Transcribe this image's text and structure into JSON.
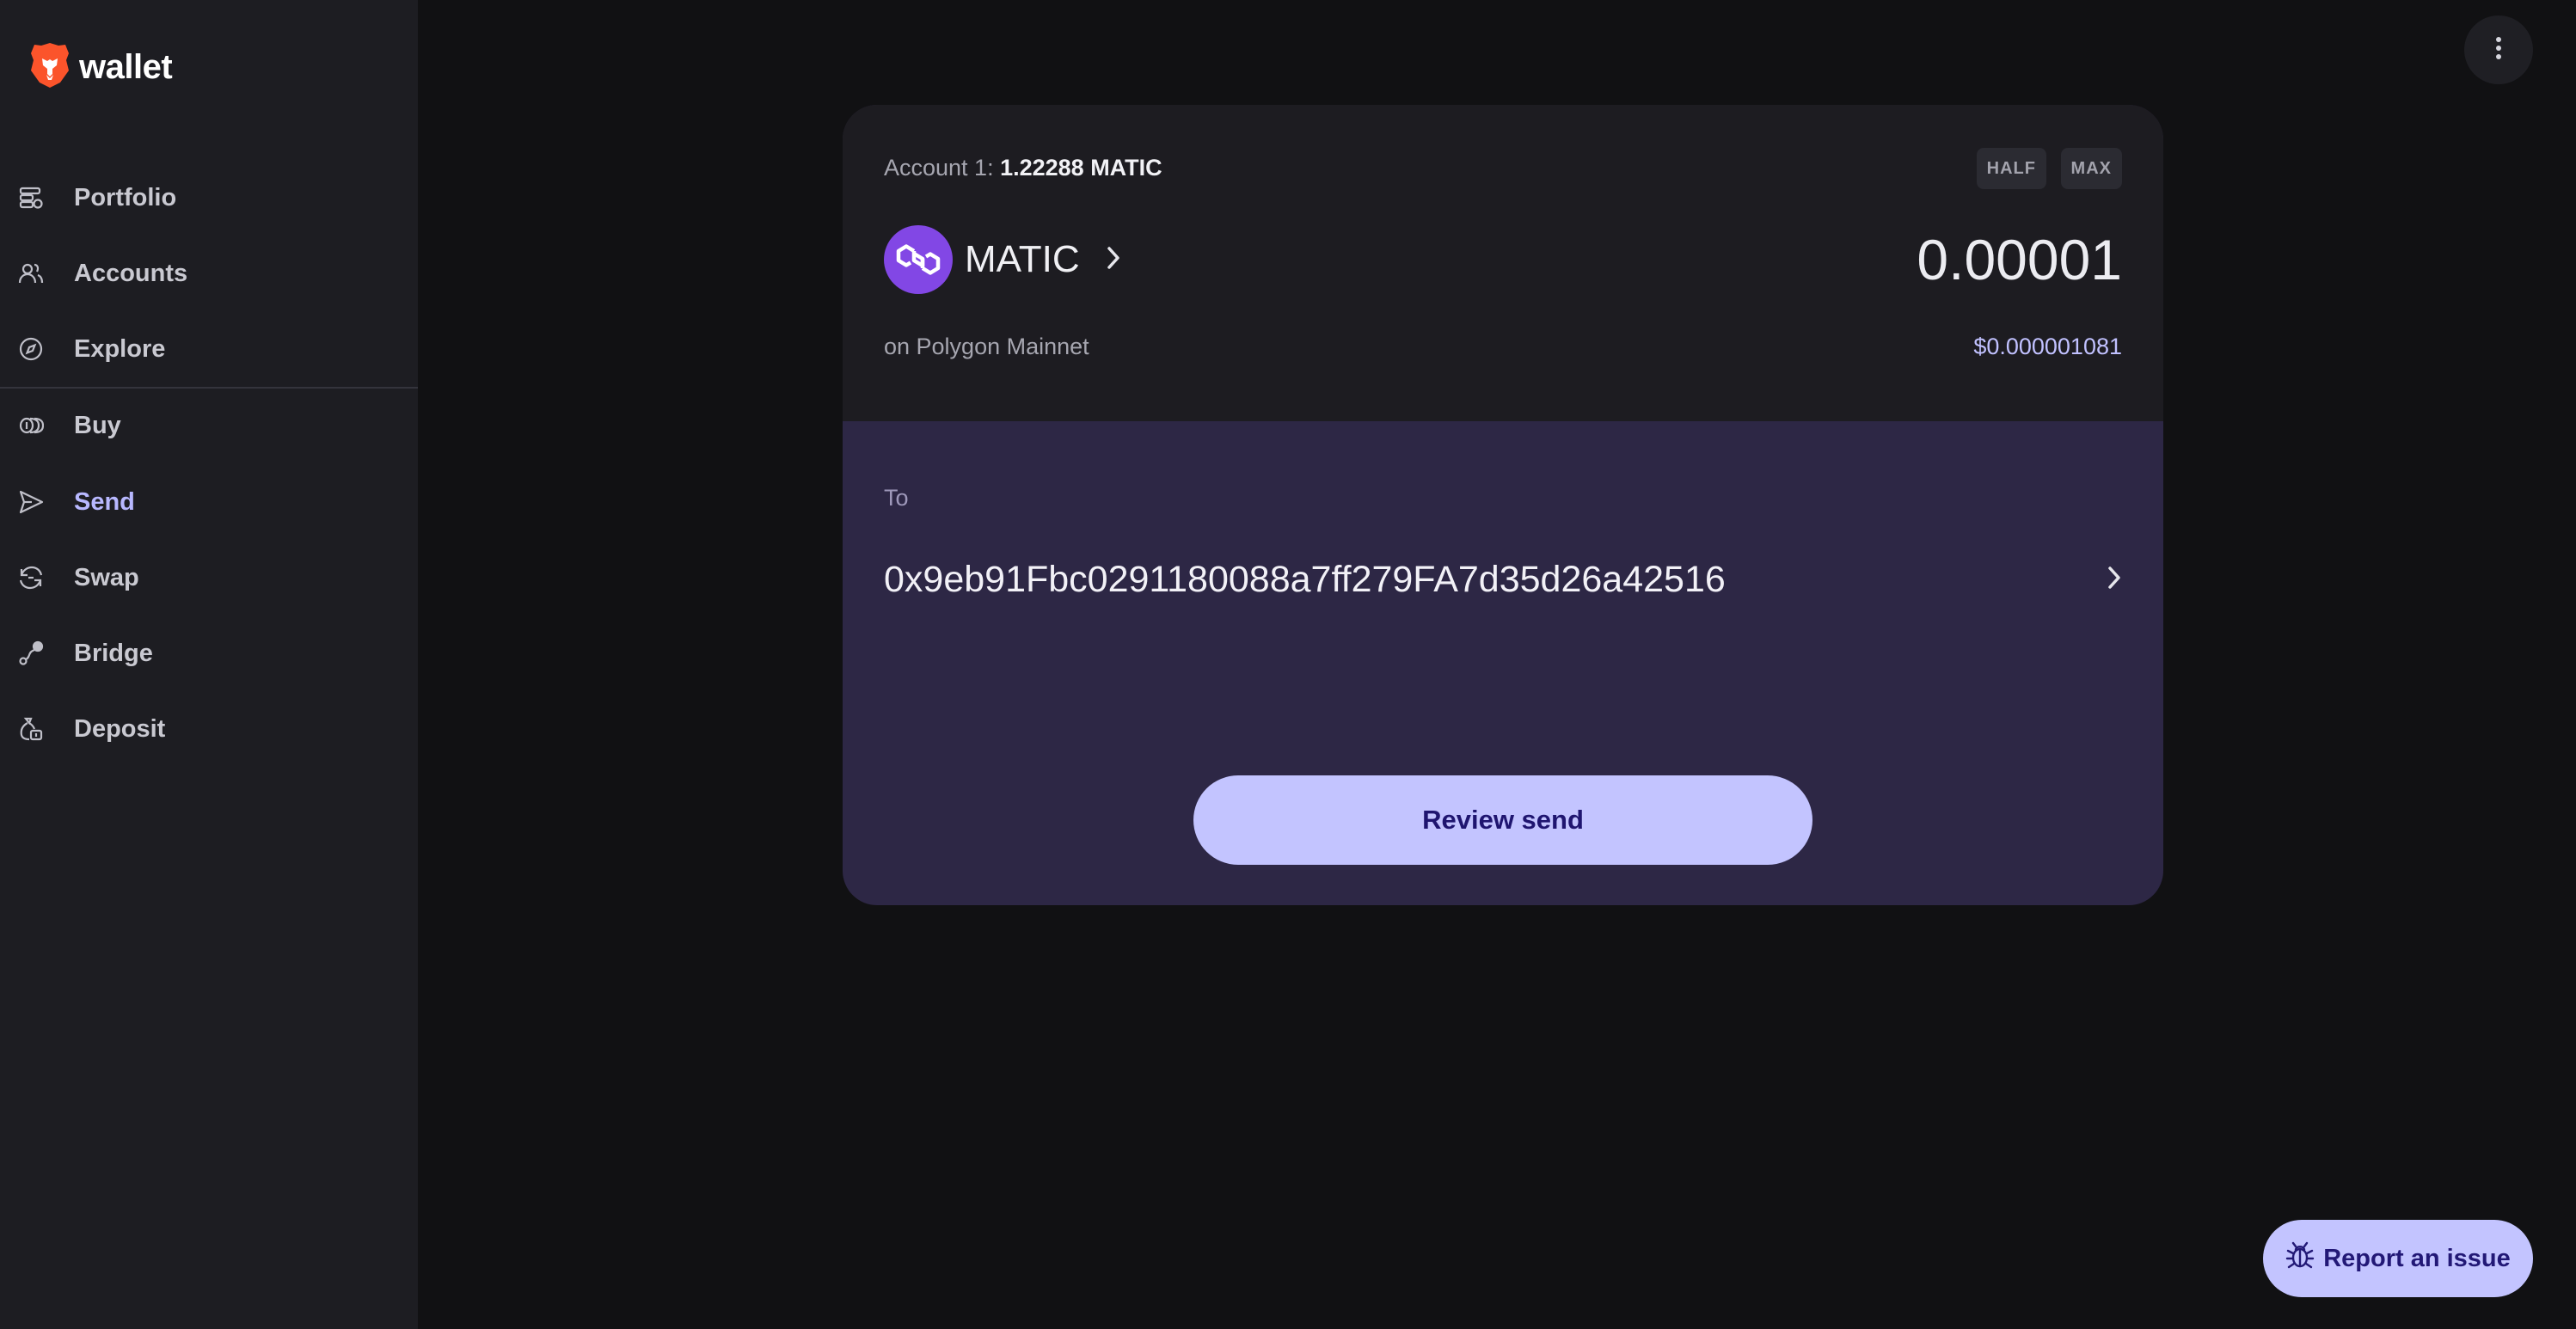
{
  "app": {
    "logo_text": "wallet"
  },
  "sidebar": {
    "items": [
      {
        "label": "Portfolio",
        "icon": "portfolio-icon"
      },
      {
        "label": "Accounts",
        "icon": "accounts-icon"
      },
      {
        "label": "Explore",
        "icon": "compass-icon"
      },
      {
        "label": "Buy",
        "icon": "coins-icon"
      },
      {
        "label": "Send",
        "icon": "send-icon",
        "active": true
      },
      {
        "label": "Swap",
        "icon": "swap-icon"
      },
      {
        "label": "Bridge",
        "icon": "bridge-icon"
      },
      {
        "label": "Deposit",
        "icon": "deposit-icon"
      }
    ]
  },
  "send": {
    "account_label": "Account 1:",
    "account_balance": "1.22288 MATIC",
    "half_label": "HALF",
    "max_label": "MAX",
    "token_symbol": "MATIC",
    "amount": "0.00001",
    "network": "on Polygon Mainnet",
    "fiat_value": "$0.000001081",
    "to_label": "To",
    "to_address": "0x9eb91Fbc0291180088a7ff279FA7d35d26a42516",
    "review_label": "Review send"
  },
  "report": {
    "label": "Report an issue"
  },
  "colors": {
    "background": "#111113",
    "sidebar": "#1d1d22",
    "accent": "#c3c4ff",
    "card_bottom": "#2d2745",
    "polygon": "#8247e5"
  }
}
